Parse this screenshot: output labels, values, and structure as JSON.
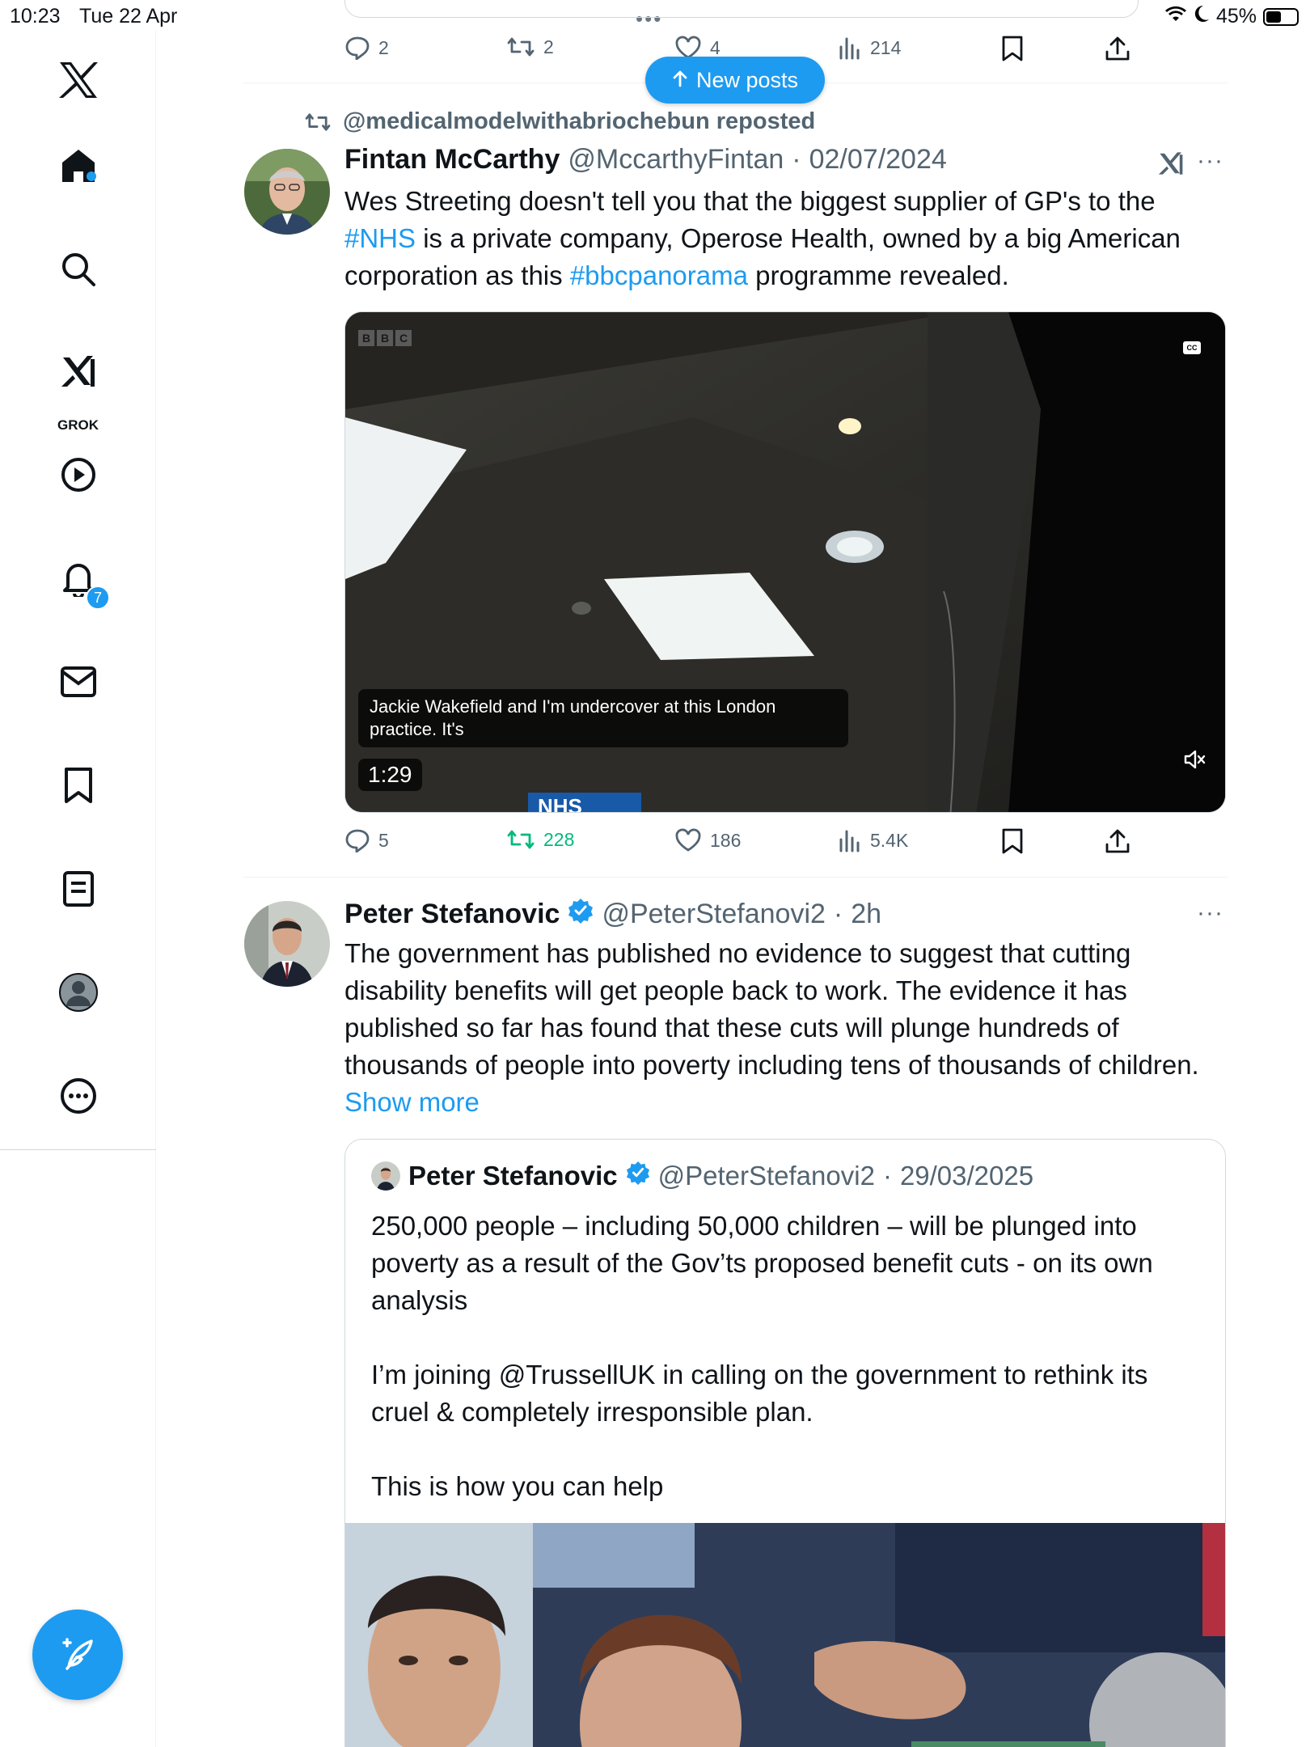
{
  "status_bar": {
    "time": "10:23",
    "date": "Tue 22 Apr",
    "battery": "45%",
    "battery_level": 0.45
  },
  "sidebar": {
    "items": [
      {
        "name": "logo",
        "icon": "x-logo-icon"
      },
      {
        "name": "home",
        "icon": "home-icon"
      },
      {
        "name": "explore",
        "icon": "search-icon"
      },
      {
        "name": "grok",
        "icon": "grok-icon",
        "label": "GROK"
      },
      {
        "name": "videos",
        "icon": "play-icon"
      },
      {
        "name": "notifications",
        "icon": "bell-icon",
        "badge": "7"
      },
      {
        "name": "messages",
        "icon": "mail-icon"
      },
      {
        "name": "bookmarks",
        "icon": "bookmark-icon"
      },
      {
        "name": "lists",
        "icon": "list-icon"
      },
      {
        "name": "profile",
        "icon": "avatar-icon"
      },
      {
        "name": "more",
        "icon": "more-icon"
      }
    ],
    "compose_icon": "compose-feather-icon"
  },
  "new_posts": {
    "label": "New posts"
  },
  "prev_tweet": {
    "replies": "2",
    "reposts": "2",
    "likes": "4",
    "views": "214"
  },
  "tweet1": {
    "reposted_by": "@medicalmodelwithabriochebun reposted",
    "name": "Fintan McCarthy",
    "handle": "@MccarthyFintan",
    "sep": "·",
    "date": "02/07/2024",
    "text_parts": [
      {
        "t": "Wes Streeting doesn't tell you that the biggest supplier of GP's to  the ",
        "link": false
      },
      {
        "t": "#NHS",
        "link": true
      },
      {
        "t": " is a private company, Operose Health, owned by a big American corporation as this ",
        "link": false
      },
      {
        "t": "#bbcpanorama",
        "link": true
      },
      {
        "t": " programme revealed.",
        "link": false
      }
    ],
    "video": {
      "caption": "Jackie Wakefield and I'm undercover at this London practice. It's",
      "duration": "1:29",
      "bbc": [
        "B",
        "B",
        "C"
      ],
      "cc": "CC",
      "sign_text": "NHS"
    },
    "replies": "5",
    "reposts": "228",
    "likes": "186",
    "views": "5.4K"
  },
  "tweet2": {
    "name": "Peter Stefanovic",
    "handle": "@PeterStefanovi2",
    "sep": "·",
    "time": "2h",
    "text": "The government has published no evidence to suggest that cutting disability benefits will get people back to work. The evidence it has published so far has found that these cuts will plunge hundreds of thousands of people into poverty including tens of thousands of children.",
    "show_more": "Show more",
    "quote": {
      "name": "Peter Stefanovic",
      "handle": "@PeterStefanovi2",
      "sep": "·",
      "date": "29/03/2025",
      "paragraphs": [
        "250,000 people – including 50,000 children – will be plunged into poverty as a result of the Gov’ts proposed benefit cuts - on its own analysis",
        "",
        "I’m joining @TrussellUK in calling on the government to rethink its cruel & completely irresponsible plan.",
        "",
        "This is how you can help"
      ]
    }
  },
  "colors": {
    "accent": "#1d9bf0",
    "repost_active": "#00ba7c",
    "muted_text": "#536471",
    "verified": "#1d9bf0"
  }
}
